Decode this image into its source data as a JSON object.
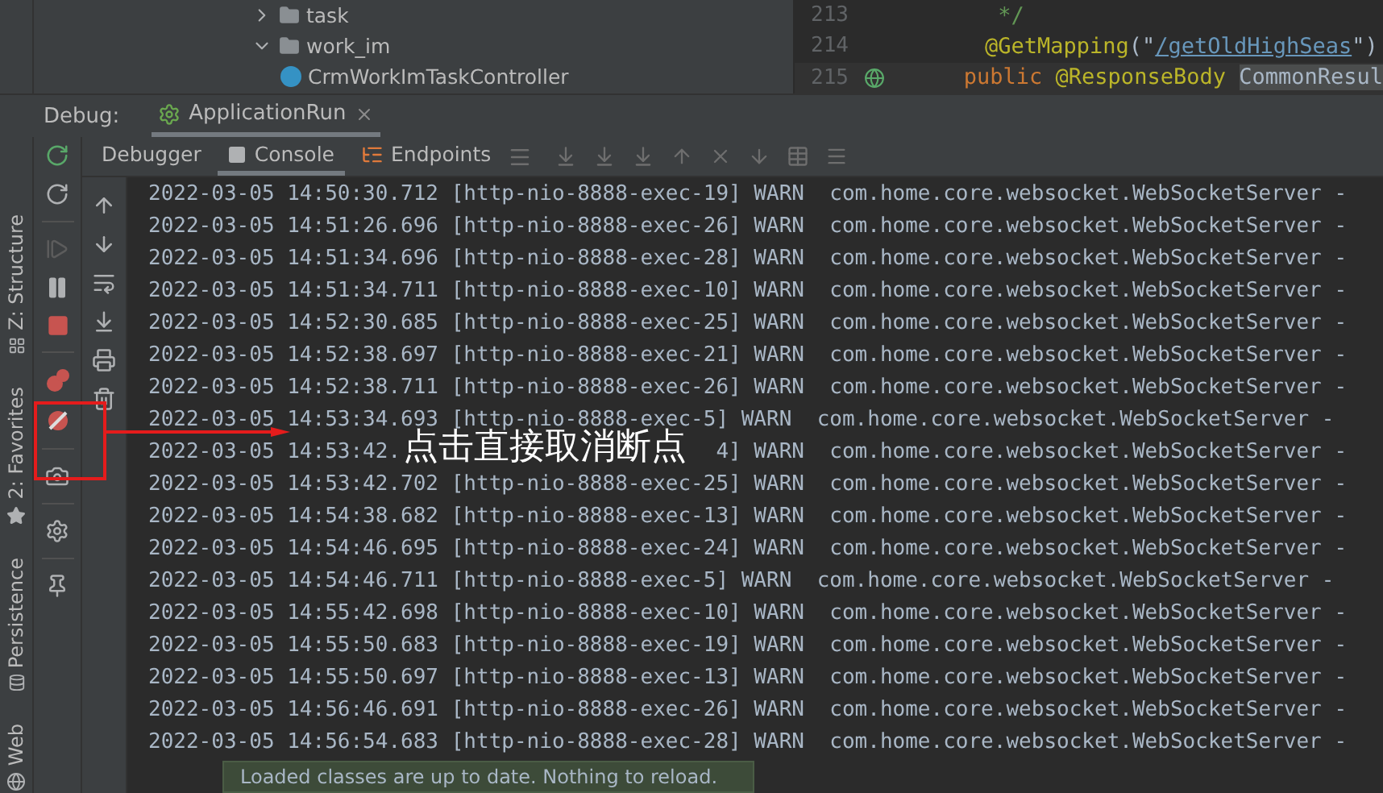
{
  "project_tree": [
    {
      "label": "task",
      "expanded": false
    },
    {
      "label": "work_im",
      "expanded": true,
      "children": [
        {
          "label": "CrmWorkImTaskController"
        }
      ]
    }
  ],
  "editor": {
    "lines": [
      {
        "number": "213",
        "tokens": [
          {
            "kind": "comment",
            "text": " */"
          }
        ]
      },
      {
        "number": "214",
        "tokens": [
          {
            "kind": "annotation",
            "text": "@GetMapping"
          },
          {
            "kind": "plain",
            "text": "(\""
          },
          {
            "kind": "string",
            "text": "/getOldHighSeas"
          },
          {
            "kind": "plain",
            "text": "\")"
          }
        ]
      },
      {
        "number": "215",
        "current": true,
        "tokens": [
          {
            "kind": "keyword",
            "text": "public "
          },
          {
            "kind": "annotation",
            "text": "@ResponseBody "
          },
          {
            "kind": "highlight",
            "text": "CommonResul"
          }
        ]
      }
    ]
  },
  "debug_bar": {
    "label": "Debug:",
    "tabs": [
      {
        "label": "ApplicationRun",
        "selected": true
      }
    ]
  },
  "toolbar_tabs": [
    {
      "label": "Debugger",
      "selected": false,
      "kind": "debugger"
    },
    {
      "label": "Console",
      "selected": true,
      "kind": "console"
    },
    {
      "label": "Endpoints",
      "selected": false,
      "kind": "endpoints"
    }
  ],
  "side_tools": [
    {
      "label": "Z: Structure",
      "kind": "structure"
    },
    {
      "label": "2: Favorites",
      "kind": "favorites"
    },
    {
      "label": "Persistence",
      "kind": "persistence"
    },
    {
      "label": "Web",
      "kind": "web"
    }
  ],
  "log_rows": [
    "2022-03-05 14:50:30.712 [http-nio-8888-exec-19] WARN  com.home.core.websocket.WebSocketServer -",
    "2022-03-05 14:51:26.696 [http-nio-8888-exec-26] WARN  com.home.core.websocket.WebSocketServer -",
    "2022-03-05 14:51:34.696 [http-nio-8888-exec-28] WARN  com.home.core.websocket.WebSocketServer -",
    "2022-03-05 14:51:34.711 [http-nio-8888-exec-10] WARN  com.home.core.websocket.WebSocketServer -",
    "2022-03-05 14:52:30.685 [http-nio-8888-exec-25] WARN  com.home.core.websocket.WebSocketServer -",
    "2022-03-05 14:52:38.697 [http-nio-8888-exec-21] WARN  com.home.core.websocket.WebSocketServer -",
    "2022-03-05 14:52:38.711 [http-nio-8888-exec-26] WARN  com.home.core.websocket.WebSocketServer -",
    "2022-03-05 14:53:34.693 [http-nio-8888-exec-5] WARN  com.home.core.websocket.WebSocketServer -",
    [
      "2022-03-05 14:53:42.",
      "4] WARN  com.home.core.websocket.WebSocketServer -"
    ],
    "2022-03-05 14:53:42.702 [http-nio-8888-exec-25] WARN  com.home.core.websocket.WebSocketServer -",
    "2022-03-05 14:54:38.682 [http-nio-8888-exec-13] WARN  com.home.core.websocket.WebSocketServer -",
    "2022-03-05 14:54:46.695 [http-nio-8888-exec-24] WARN  com.home.core.websocket.WebSocketServer -",
    "2022-03-05 14:54:46.711 [http-nio-8888-exec-5] WARN  com.home.core.websocket.WebSocketServer -",
    "2022-03-05 14:55:42.698 [http-nio-8888-exec-10] WARN  com.home.core.websocket.WebSocketServer -",
    "2022-03-05 14:55:50.683 [http-nio-8888-exec-19] WARN  com.home.core.websocket.WebSocketServer -",
    "2022-03-05 14:55:50.697 [http-nio-8888-exec-13] WARN  com.home.core.websocket.WebSocketServer -",
    "2022-03-05 14:56:46.691 [http-nio-8888-exec-26] WARN  com.home.core.websocket.WebSocketServer -",
    "2022-03-05 14:56:54.683 [http-nio-8888-exec-28] WARN  com.home.core.websocket.WebSocketServer -"
  ],
  "annotation": {
    "text": "点击直接取消断点"
  },
  "notification": {
    "text": "Loaded classes are up to date. Nothing to reload."
  }
}
